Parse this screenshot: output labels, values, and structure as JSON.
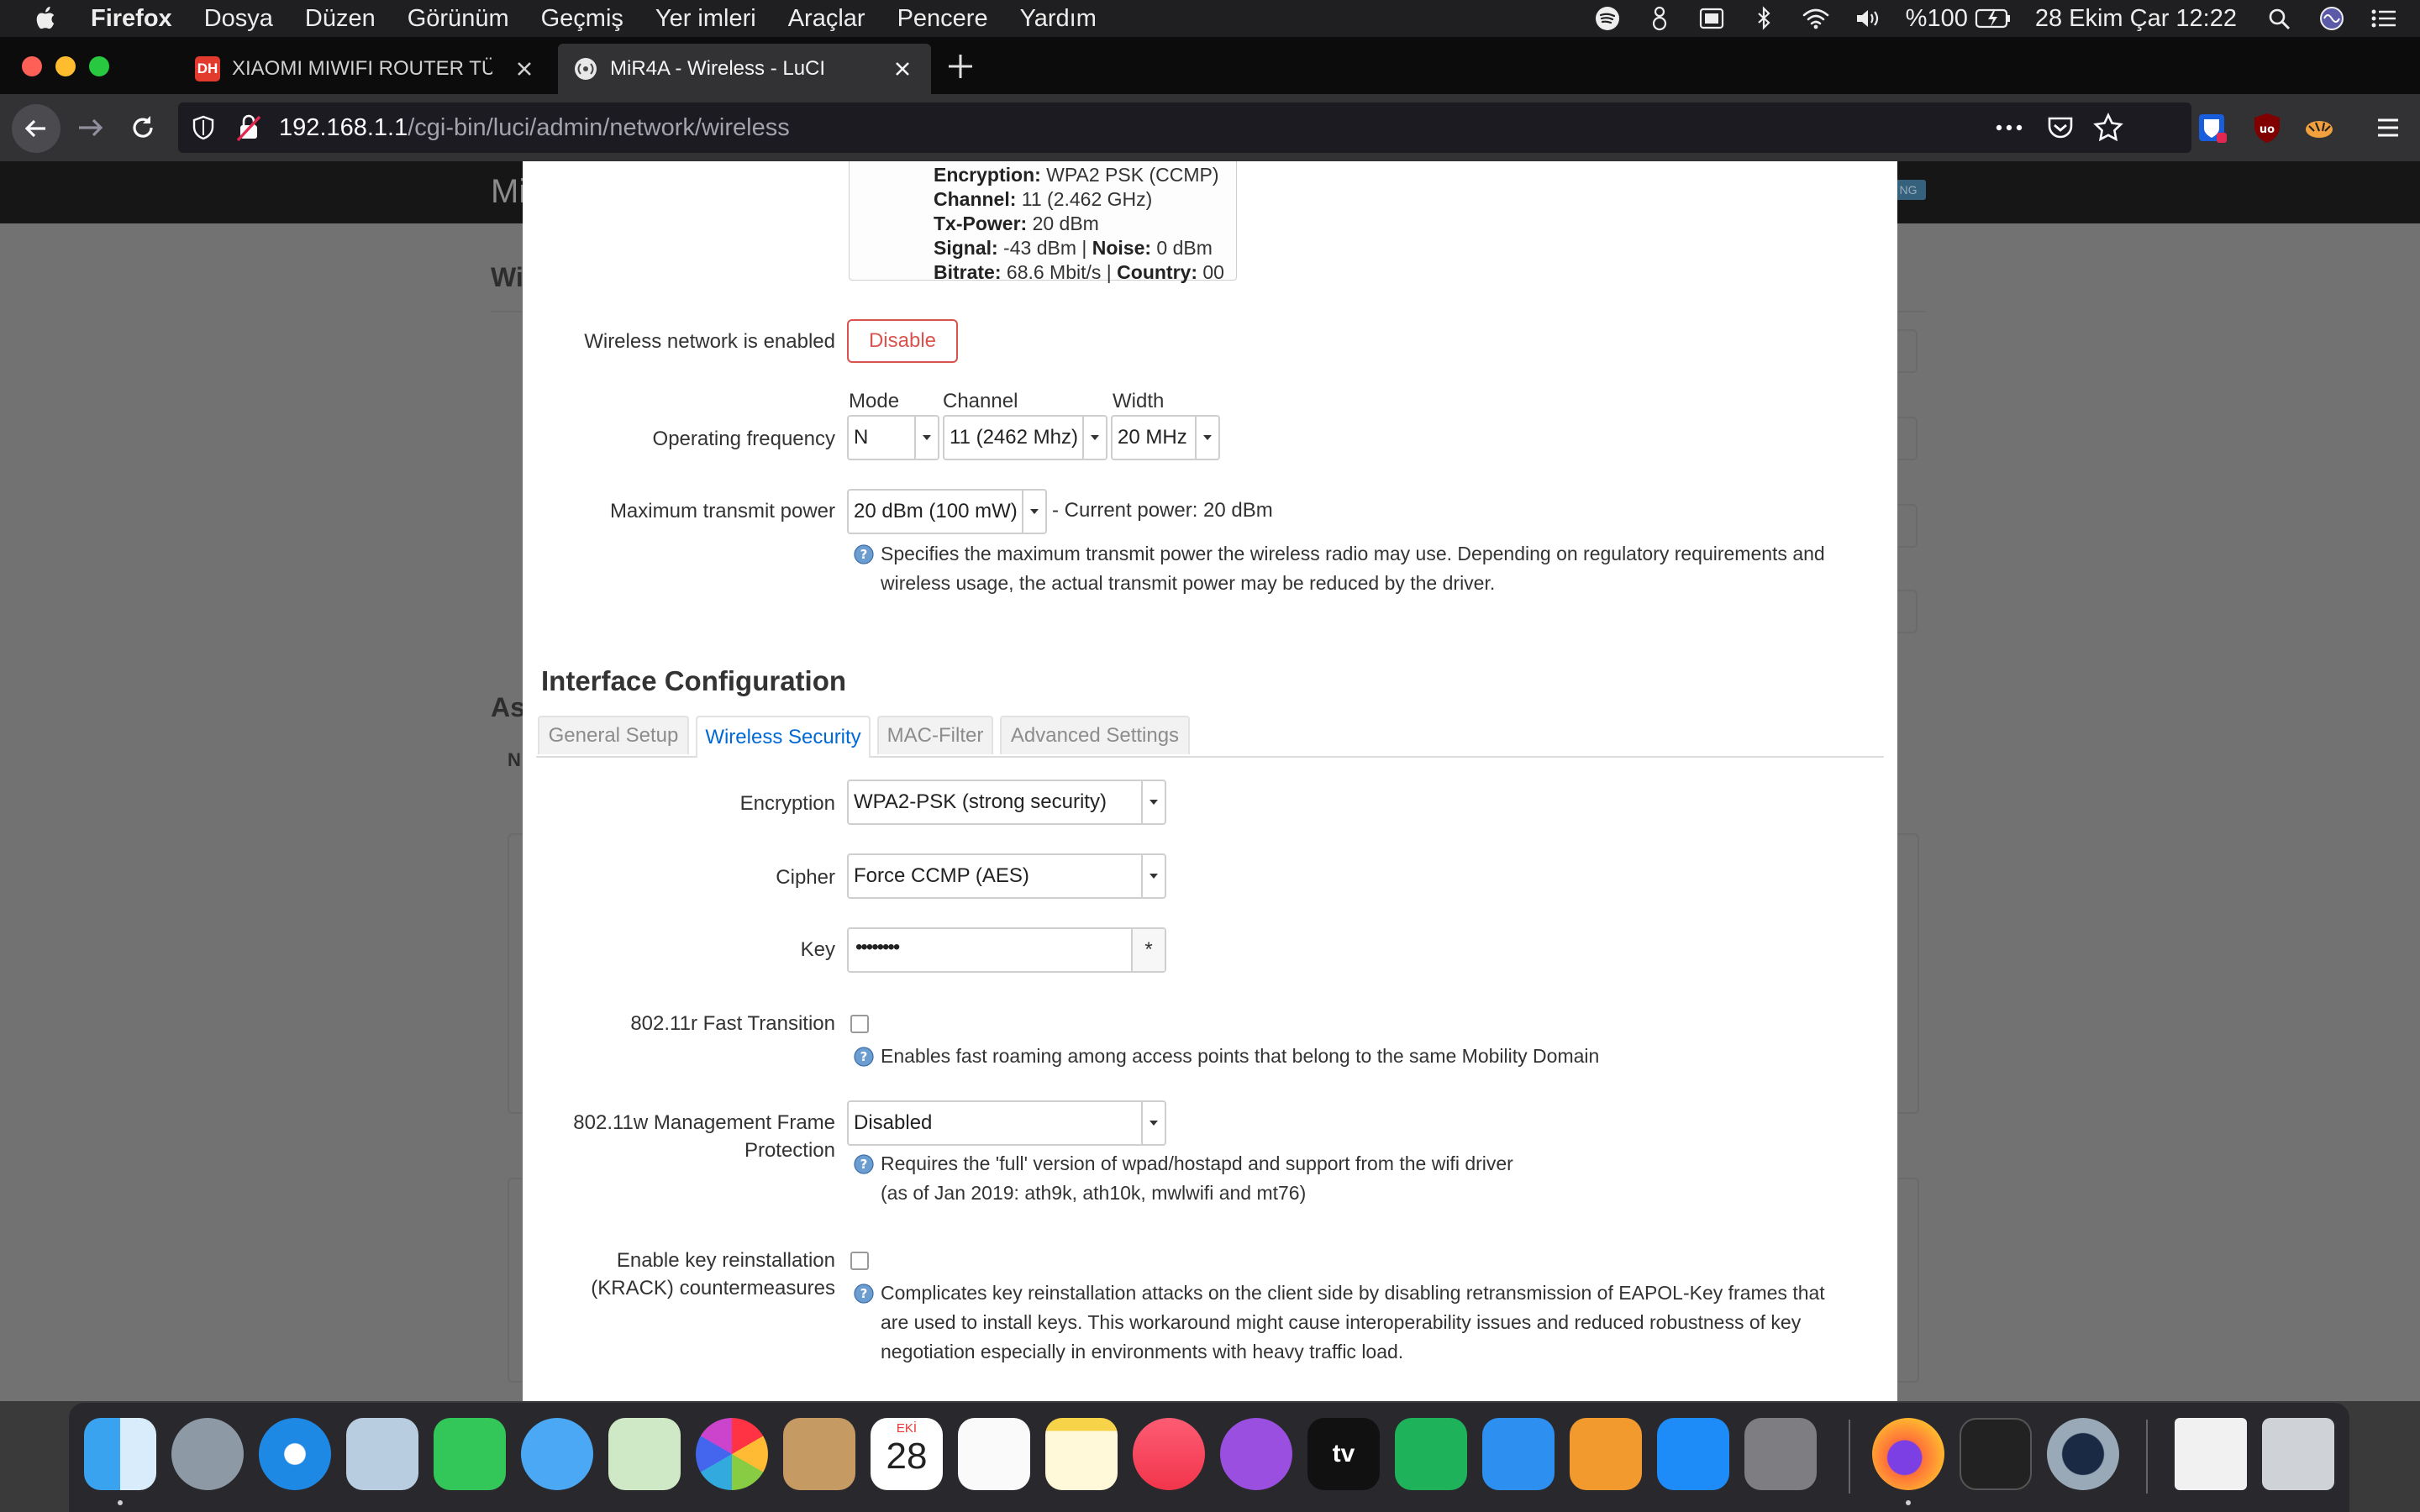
{
  "menubar": {
    "app": "Firefox",
    "items": [
      "Dosya",
      "Düzen",
      "Görünüm",
      "Geçmiş",
      "Yer imleri",
      "Araçlar",
      "Pencere",
      "Yardım"
    ],
    "battery": "%100",
    "datetime": "28 Ekim Çar  12:22"
  },
  "tabs": [
    {
      "title": "XIAOMI MIWIFI ROUTER TÜM M",
      "favicon": "DH",
      "active": false
    },
    {
      "title": "MiR4A - Wireless - LuCI",
      "active": true
    }
  ],
  "urlbar": {
    "host": "192.168.1.1",
    "path": "/cgi-bin/luci/admin/network/wireless"
  },
  "background": {
    "brand": "Mi",
    "heading1": "Wi",
    "heading2": "As",
    "heading3": "N"
  },
  "status": {
    "encryption_label": "Encryption:",
    "encryption_value": " WPA2 PSK (CCMP)",
    "channel_label": "Channel:",
    "channel_value": " 11 (2.462 GHz)",
    "txpower_label": "Tx-Power:",
    "txpower_value": " 20 dBm",
    "signal_label": "Signal:",
    "signal_value": " -43 dBm | ",
    "noise_label": "Noise:",
    "noise_value": " 0 dBm",
    "bitrate_label": "Bitrate:",
    "bitrate_value": " 68.6 Mbit/s | ",
    "country_label": "Country:",
    "country_value": " 00"
  },
  "device": {
    "enabled_label": "Wireless network is enabled",
    "disable_button": "Disable",
    "freq_label": "Operating frequency",
    "mode_label": "Mode",
    "channel_label": "Channel",
    "width_label": "Width",
    "mode_value": "N",
    "channel_value": "11 (2462 Mhz)",
    "width_value": "20 MHz",
    "txpower_label": "Maximum transmit power",
    "txpower_value": "20 dBm (100 mW)",
    "current_power": "- Current power: 20 dBm",
    "txpower_desc_1": "Specifies the maximum transmit power the wireless radio may use. Depending on regulatory requirements and",
    "txpower_desc_2": "wireless usage, the actual transmit power may be reduced by the driver."
  },
  "interface": {
    "title": "Interface Configuration",
    "tabs": [
      "General Setup",
      "Wireless Security",
      "MAC-Filter",
      "Advanced Settings"
    ],
    "active_tab": "Wireless Security",
    "encryption_label": "Encryption",
    "encryption_value": "WPA2-PSK (strong security)",
    "cipher_label": "Cipher",
    "cipher_value": "Force CCMP (AES)",
    "key_label": "Key",
    "key_value": "••••••••",
    "key_reveal": "*",
    "ft_label": "802.11r Fast Transition",
    "ft_desc": "Enables fast roaming among access points that belong to the same Mobility Domain",
    "mfp_label_1": "802.11w Management Frame",
    "mfp_label_2": "Protection",
    "mfp_value": "Disabled",
    "mfp_desc_1": "Requires the 'full' version of wpad/hostapd and support from the wifi driver",
    "mfp_desc_2": "(as of Jan 2019: ath9k, ath10k, mwlwifi and mt76)",
    "krack_label_1": "Enable key reinstallation",
    "krack_label_2": "(KRACK) countermeasures",
    "krack_desc_1": "Complicates key reinstallation attacks on the client side by disabling retransmission of EAPOL-Key frames that",
    "krack_desc_2": "are used to install keys. This workaround might cause interoperability issues and reduced robustness of key",
    "krack_desc_3": "negotiation especially in environments with heavy traffic load."
  },
  "dock": {
    "calendar_month": "EKİ",
    "calendar_day": "28",
    "tv_label": "tv",
    "apps": [
      "finder",
      "launchpad",
      "safari",
      "preview",
      "facetime",
      "messages",
      "maps",
      "photos",
      "contacts",
      "calendar",
      "reminders",
      "notes",
      "music",
      "podcasts",
      "tv",
      "numbers",
      "keynote",
      "pages",
      "app-store",
      "system-preferences",
      "firefox",
      "terminal",
      "quicktime",
      "documents",
      "trash"
    ]
  },
  "colors": {
    "accent_blue": "#0069d6",
    "danger_red": "#d9534f",
    "menubar_bg": "#1f1f21",
    "toolbar_bg": "#323234"
  }
}
